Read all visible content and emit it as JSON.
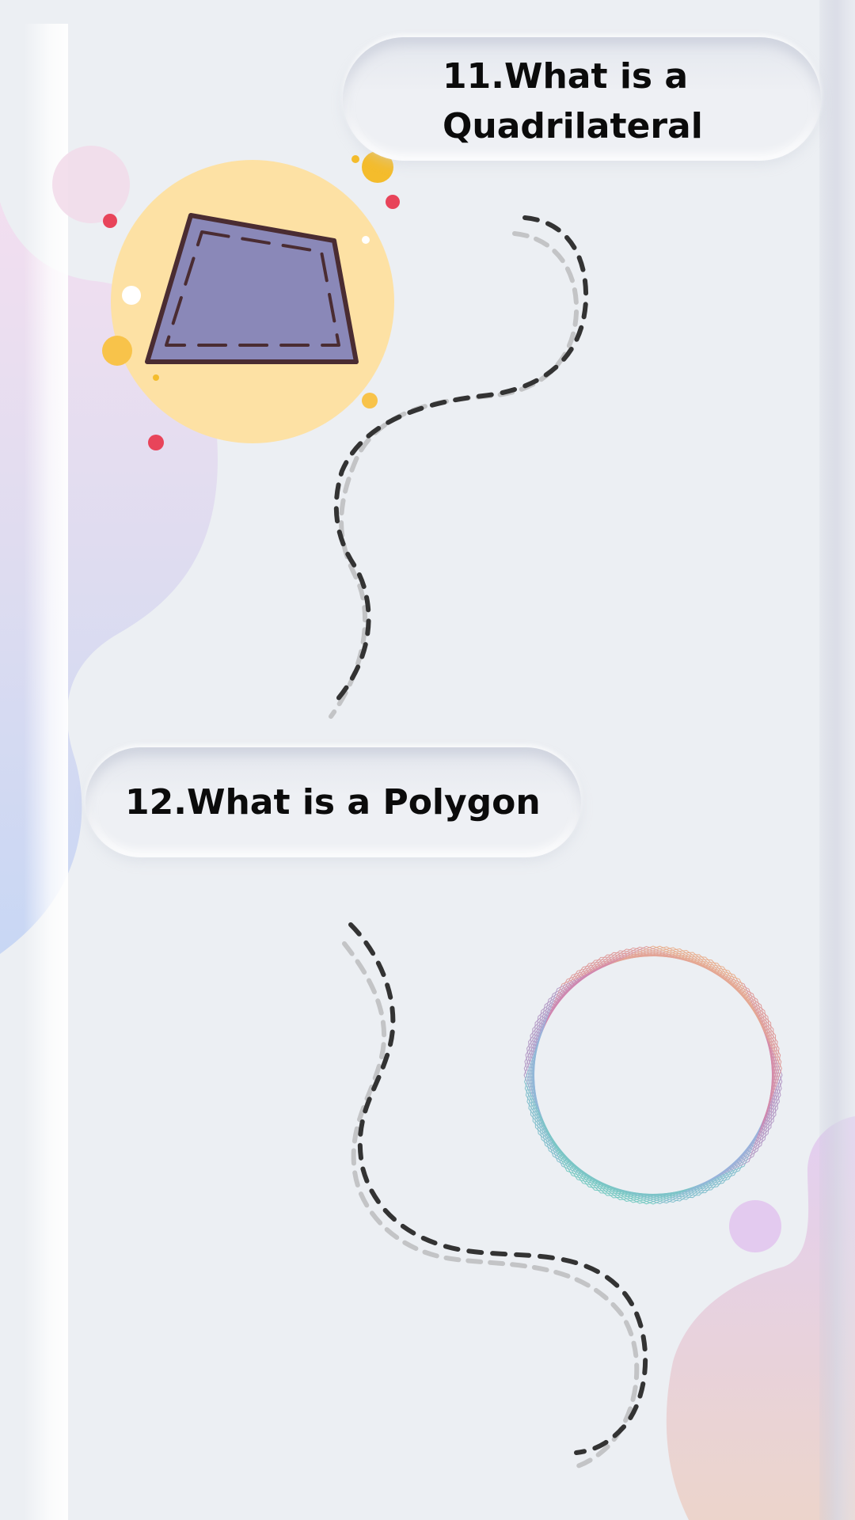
{
  "slide": {
    "question_11": {
      "line1": "11.What is a",
      "line2": "Quadrilateral"
    },
    "question_12": {
      "title": "12.What is a Polygon"
    }
  },
  "colors": {
    "background": "#eceff3",
    "quadrilateral_fill": "#8a88b8",
    "quadrilateral_outline": "#4a2c32",
    "sun_circle": "#fde1a4",
    "accent_red": "#e8445a",
    "accent_yellow": "#f4bc2c",
    "dash_dark": "#333333",
    "dash_light": "#c3c4c6"
  },
  "icons": {
    "quadrilateral": "quadrilateral-illustration-icon",
    "polygon": "octagon-spirograph-icon"
  }
}
